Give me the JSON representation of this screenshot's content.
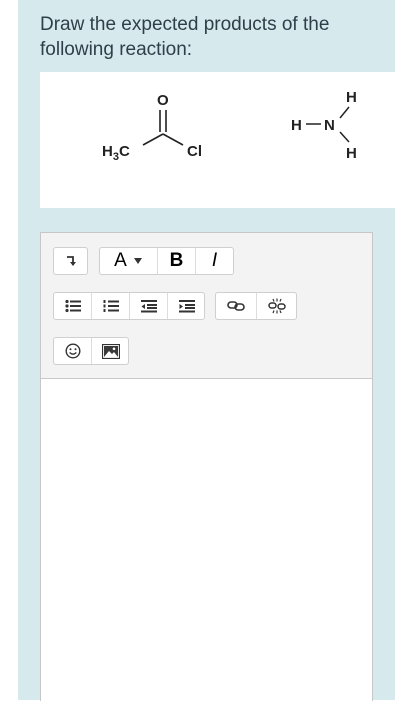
{
  "question": {
    "text": "Draw the expected products of the following reaction:"
  },
  "reaction": {
    "reactant1": {
      "left_group": "H3C",
      "carbonyl_atom": "O",
      "right_group": "Cl"
    },
    "reactant2": {
      "top_h": "H",
      "left_h": "H",
      "n_atom": "N",
      "bottom_h": "H"
    }
  },
  "toolbar": {
    "row1": [
      {
        "name": "collapse-toolbar",
        "icon": "arrow-down-right"
      },
      {
        "name": "font-color",
        "label": "A"
      },
      {
        "name": "bold",
        "label": "B"
      },
      {
        "name": "italic",
        "label": "I"
      }
    ],
    "row2": [
      "unordered-list",
      "ordered-list",
      "outdent",
      "indent",
      "link",
      "unlink"
    ],
    "row3": [
      "emoji",
      "image"
    ]
  }
}
